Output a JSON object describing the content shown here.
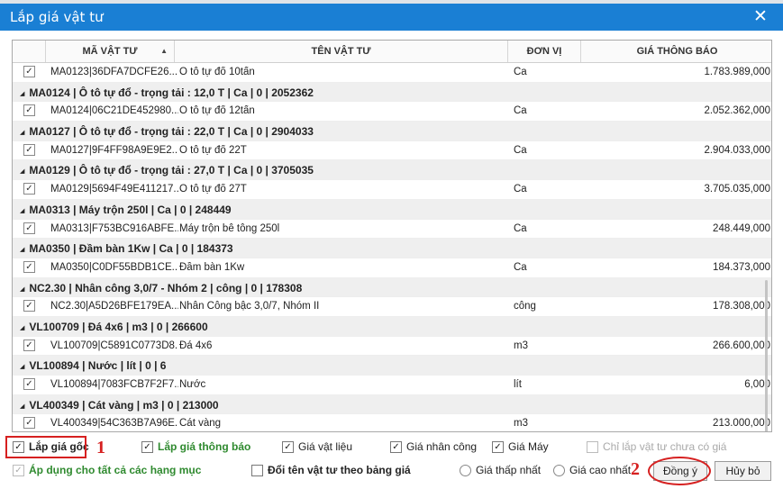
{
  "window": {
    "title": "Lắp giá vật tư"
  },
  "icons": {
    "close": "close-icon",
    "sort": "sort-ascending-icon",
    "check": "checkmark-icon"
  },
  "colors": {
    "titlebar": "#1a7fd4",
    "accent_green": "#2f8a2f",
    "annotation_red": "#d62020"
  },
  "grid": {
    "columns": [
      "MÃ VẬT TƯ",
      "TÊN VẬT TƯ",
      "ĐƠN VỊ",
      "GIÁ THÔNG BÁO"
    ],
    "rows": [
      {
        "type": "item",
        "checked": true,
        "code": "MA0123|36DFA7DCFE26...",
        "name": "Ô tô tự đổ 10tấn",
        "unit": "Ca",
        "price": "1.783.989,000"
      },
      {
        "type": "group",
        "text": "MA0124 | Ô tô tự đổ - trọng tải : 12,0 T | Ca | 0 | 2052362"
      },
      {
        "type": "item",
        "checked": true,
        "code": "MA0124|06C21DE452980...",
        "name": "Ô tô tự đổ 12tấn",
        "unit": "Ca",
        "price": "2.052.362,000"
      },
      {
        "type": "group",
        "text": "MA0127 | Ô tô tự đổ - trọng tải : 22,0 T | Ca | 0 | 2904033"
      },
      {
        "type": "item",
        "checked": true,
        "code": "MA0127|9F4FF98A9E9E2...",
        "name": "Ô tô tự đổ 22T",
        "unit": "Ca",
        "price": "2.904.033,000"
      },
      {
        "type": "group",
        "text": "MA0129 | Ô tô tự đổ - trọng tải : 27,0 T | Ca | 0 | 3705035"
      },
      {
        "type": "item",
        "checked": true,
        "code": "MA0129|5694F49E411217...",
        "name": "Ô tô tự đổ 27T",
        "unit": "Ca",
        "price": "3.705.035,000"
      },
      {
        "type": "group",
        "text": "MA0313 | Máy trộn 250l | Ca | 0 | 248449"
      },
      {
        "type": "item",
        "checked": true,
        "code": "MA0313|F753BC916ABFE...",
        "name": "Máy trộn bê tông 250l",
        "unit": "Ca",
        "price": "248.449,000"
      },
      {
        "type": "group",
        "text": "MA0350 | Đầm bàn 1Kw | Ca | 0 | 184373"
      },
      {
        "type": "item",
        "checked": true,
        "code": "MA0350|C0DF55BDB1CE...",
        "name": "Đầm bàn 1Kw",
        "unit": "Ca",
        "price": "184.373,000"
      },
      {
        "type": "group",
        "text": "NC2.30 | Nhân công 3,0/7 - Nhóm 2 | công | 0 | 178308"
      },
      {
        "type": "item",
        "checked": true,
        "code": "NC2.30|A5D26BFE179EA...",
        "name": "Nhân Công bậc 3,0/7, Nhóm II",
        "unit": "công",
        "price": "178.308,000"
      },
      {
        "type": "group",
        "text": "VL100709 | Đá 4x6 | m3 | 0 | 266600"
      },
      {
        "type": "item",
        "checked": true,
        "code": "VL100709|C5891C0773D8...",
        "name": "Đá 4x6",
        "unit": "m3",
        "price": "266.600,000"
      },
      {
        "type": "group",
        "text": "VL100894 | Nước | lít | 0 | 6"
      },
      {
        "type": "item",
        "checked": true,
        "code": "VL100894|7083FCB7F2F7...",
        "name": "Nước",
        "unit": "lít",
        "price": "6,000"
      },
      {
        "type": "group",
        "text": "VL400349 | Cát vàng | m3 | 0 | 213000"
      },
      {
        "type": "item",
        "checked": true,
        "code": "VL400349|54C363B7A96E...",
        "name": "Cát vàng",
        "unit": "m3",
        "price": "213.000,000"
      }
    ]
  },
  "options": {
    "lap_gia_goc": "Lắp giá gốc",
    "lap_gia_thong_bao": "Lắp giá thông báo",
    "gia_vat_lieu": "Giá vật liệu",
    "gia_nhan_cong": "Giá nhân công",
    "gia_may": "Giá Máy",
    "chi_lap_vat_tu": "Chỉ lắp vật tư chưa có giá",
    "ap_dung": "Áp dụng cho tất cả các hạng mục",
    "doi_ten": "Đổi tên vật tư theo bảng giá",
    "gia_thap_nhat": "Giá thấp nhất",
    "gia_cao_nhat": "Giá cao nhất"
  },
  "buttons": {
    "ok": "Đồng ý",
    "cancel": "Hủy bỏ"
  },
  "annotations": {
    "one": "1",
    "two": "2"
  }
}
